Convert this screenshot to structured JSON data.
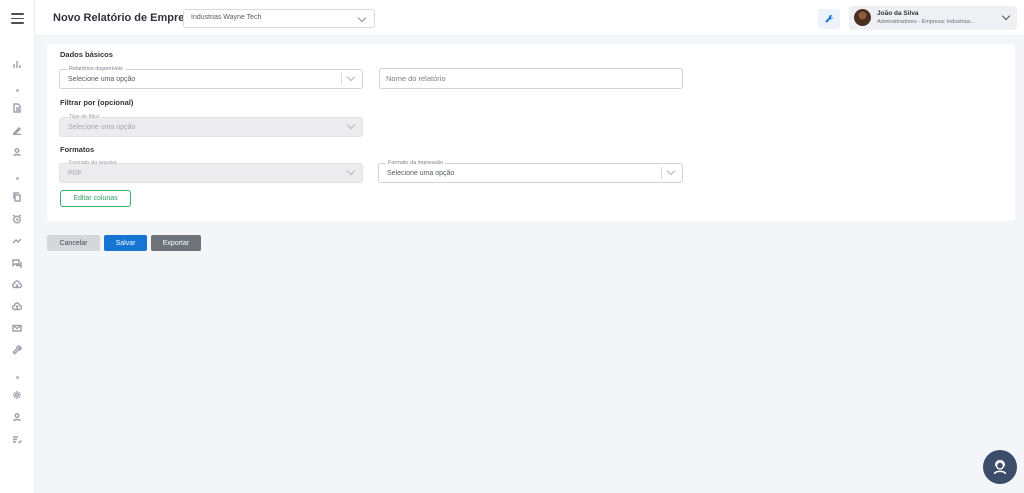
{
  "sidebar": {
    "menu_icon": "hamburger-icon",
    "icons": [
      "chart-bar-icon",
      "document-icon",
      "pen-icon",
      "user-icon",
      "copy-icon",
      "alarm-icon",
      "trend-icon",
      "chat-icon",
      "cloud-download-icon",
      "cloud-upload-icon",
      "mail-icon",
      "wrench-icon",
      "gear-icon",
      "person-icon",
      "checklist-icon"
    ]
  },
  "header": {
    "title": "Novo Relatório de Empresas",
    "company_select": {
      "value": "Industrias Wayne Tech"
    },
    "user": {
      "name": "João da Silva",
      "role": "Administradores - Empresa: Industrias..."
    }
  },
  "form": {
    "basic": {
      "title": "Dados básicos",
      "reports": {
        "label": "Relatórios disponíveis",
        "value": "Selecione uma opção"
      },
      "name": {
        "placeholder": "Nome do relatório"
      }
    },
    "filter": {
      "title": "Filtrar por (opcional)",
      "type": {
        "label": "Tipo de filtro",
        "value": "Selecione uma opção"
      }
    },
    "formats": {
      "title": "Formatos",
      "file": {
        "label": "Formato do arquivo",
        "value": "PDF"
      },
      "print": {
        "label": "Formato da impressão",
        "value": "Selecione uma opção"
      }
    },
    "edit_columns": "Editar colunas"
  },
  "actions": {
    "cancel": "Cancelar",
    "save": "Salvar",
    "export": "Exportar"
  },
  "colors": {
    "primary": "#1674d3",
    "success": "#2fb36a",
    "fab": "#3b4d6b"
  }
}
